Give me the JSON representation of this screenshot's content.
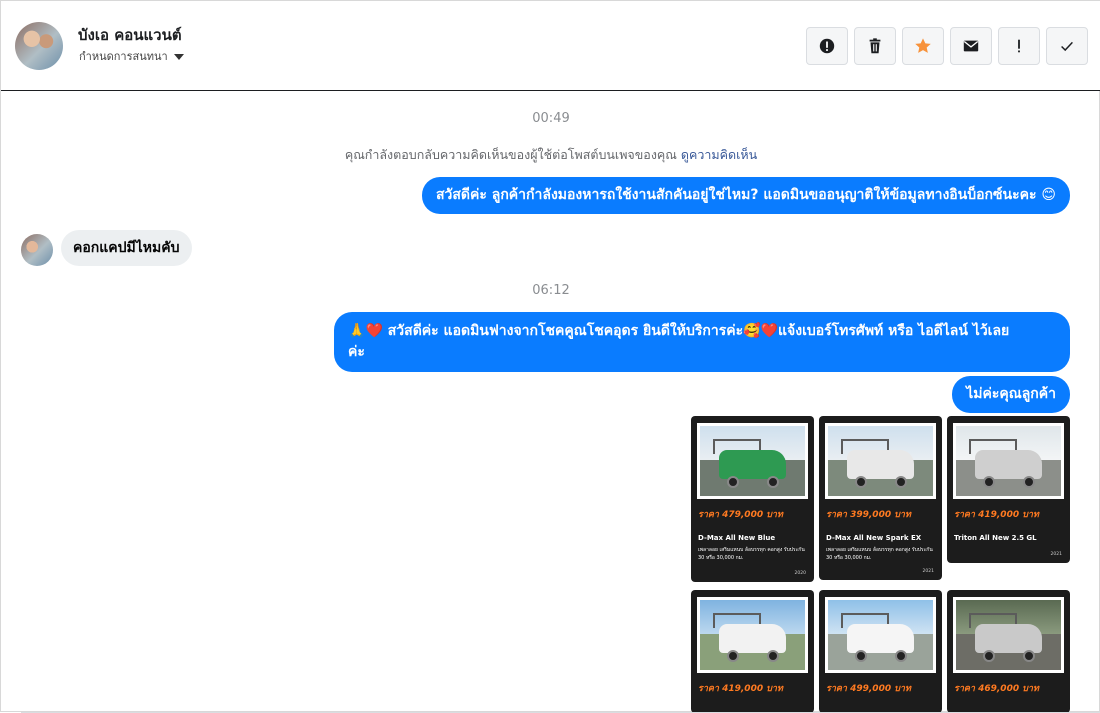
{
  "header": {
    "name": "บังเอ คอนแวนต์",
    "subtitle": "กำหนดการสนทนา",
    "actions": [
      {
        "icon": "alert-circle-icon",
        "glyph": "!"
      },
      {
        "icon": "trash-icon",
        "glyph": ""
      },
      {
        "icon": "star-icon",
        "glyph": "★"
      },
      {
        "icon": "envelope-icon",
        "glyph": "✉"
      },
      {
        "icon": "exclamation-icon",
        "glyph": "!"
      },
      {
        "icon": "check-icon",
        "glyph": "✓"
      }
    ],
    "star_color": "#f7923b"
  },
  "thread": {
    "time1": "00:49",
    "notice_text": "คุณกำลังตอบกลับความคิดเห็นของผู้ใช้ต่อโพสต์บนเพจของคุณ",
    "notice_link": "ดูความคิดเห็น",
    "msg1": "สวัสดีค่ะ ลูกค้ากำลังมองหารถใช้งานสักคันอยู่ใช่ไหม? แอดมินขออนุญาติให้ข้อมูลทางอินบ็อกซ์นะคะ",
    "msg1_emoji": "😊",
    "msg2": "คอกแคปมีไหมคับ",
    "time2": "06:12",
    "msg3_line1": "สวัสดีค่ะ แอดมินฟางจากโชคคูณโชคอุดร ยินดีให้บริการค่ะ",
    "msg3_line1b": "แจ้งเบอร์โทรศัพท์ หรือ ไอดีไลน์  ไว้เลย",
    "msg3_line2": "ค่ะ",
    "msg3_emojis": [
      "🙏",
      "❤️",
      "🥰",
      "❤️"
    ],
    "msg4": "ไม่ค่ะคุณลูกค้า",
    "bubble_color": "#0a7cff"
  },
  "cards": [
    {
      "price": "ราคา 479,000 บาท",
      "model": "D-Max All New Blue",
      "desc": "เพลาลอย เสริมแหนบ ล้อบรรทุก คอกสูง รับประกัน 30 หรือ 30,000 กม.",
      "truck_color": "#2e9a52",
      "year": "2020"
    },
    {
      "price": "ราคา 399,000 บาท",
      "model": "D-Max All New Spark EX",
      "desc": "เพลาลอย เสริมแหนบ ล้อบรรทุก คอกสูง รับประกัน 30 หรือ 30,000 กม.",
      "truck_color": "#e8e8e8",
      "year": "2021"
    },
    {
      "price": "ราคา 419,000 บาท",
      "model": "Triton All New 2.5 GL",
      "desc": "",
      "truck_color": "#cfcfcf",
      "year": "2021"
    },
    {
      "price": "ราคา 419,000 บาท",
      "model": "",
      "desc": "",
      "truck_color": "#f2f2f2",
      "year": ""
    },
    {
      "price": "ราคา 499,000 บาท",
      "model": "",
      "desc": "",
      "truck_color": "#f5f5f5",
      "year": ""
    },
    {
      "price": "ราคา 469,000 บาท",
      "model": "",
      "desc": "",
      "truck_color": "#c9c9c9",
      "year": ""
    }
  ]
}
